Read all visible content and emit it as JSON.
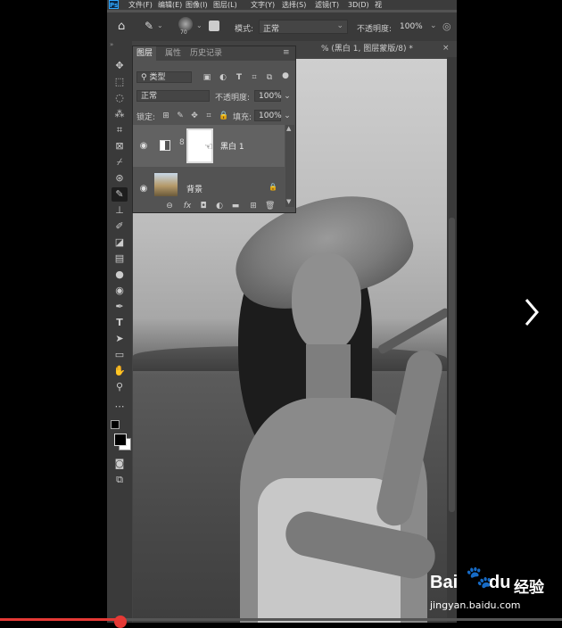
{
  "menubar": {
    "logo": "Ps",
    "items": [
      "文件(F)",
      "编辑(E)",
      "图像(I)",
      "图层(L)",
      "文字(Y)",
      "选择(S)",
      "滤镜(T)",
      "3D(D)",
      "视"
    ]
  },
  "options": {
    "brush_size": "70",
    "mode_label": "模式:",
    "mode_value": "正常",
    "opacity_label": "不透明度:",
    "opacity_value": "100%"
  },
  "document": {
    "tab_title": "% (黑白 1, 图层蒙版/8) *",
    "close": "×"
  },
  "layers_panel": {
    "tabs": [
      "图层",
      "属性",
      "历史记录"
    ],
    "filter_label": "类型",
    "blend_mode": "正常",
    "opacity_label": "不透明度:",
    "opacity_value": "100%",
    "lock_label": "锁定:",
    "fill_label": "填充:",
    "fill_value": "100%",
    "layers": [
      {
        "name": "黑白 1",
        "selected": true
      },
      {
        "name": "背景",
        "locked": true
      }
    ]
  },
  "watermark": {
    "brand": "Bai",
    "brand2": "du",
    "label": "经验",
    "url": "jingyan.baidu.com"
  },
  "colors": {
    "progress": "#e53935",
    "ps_blue": "#31a8ff"
  }
}
